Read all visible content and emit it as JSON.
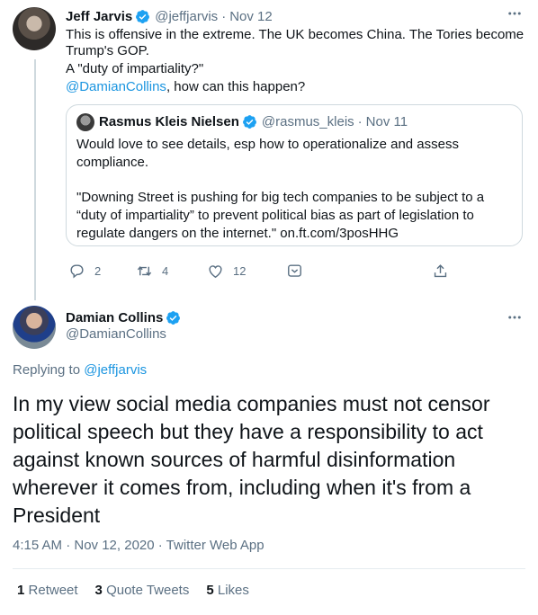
{
  "tweet1": {
    "name": "Jeff Jarvis",
    "handle": "@jeffjarvis",
    "sep": "·",
    "date": "Nov 12",
    "line1": "This is offensive in the extreme. The UK becomes China. The Tories become",
    "line2": "Trump's GOP.",
    "line3": "A \"duty of impartiality?\"",
    "mention": "@DamianCollins",
    "line4_rest": ", how can this happen?"
  },
  "quote": {
    "name": "Rasmus Kleis Nielsen",
    "handle": "@rasmus_kleis",
    "sep": "·",
    "date": "Nov 11",
    "p1_line1": "Would love to see details, esp how to operationalize and assess",
    "p1_line2": "compliance.",
    "p2_line1": "\"Downing Street is pushing for big tech companies to be subject to a",
    "p2_line2": "“duty of impartiality” to prevent political bias as part of legislation to",
    "p2_line3": "regulate dangers on the internet.\" on.ft.com/3posHHG"
  },
  "actions": {
    "reply_count": "2",
    "retweet_count": "4",
    "like_count": "12"
  },
  "tweet2": {
    "name": "Damian Collins",
    "handle": "@DamianCollins",
    "replying_label": "Replying to",
    "replying_to": "@jeffjarvis",
    "line1": "In my view social media companies must not censor",
    "line2": "political speech but they have a responsibility to act",
    "line3": "against known sources of harmful disinformation",
    "line4": "wherever it comes from, including when it's from a",
    "line5": "President",
    "meta": "4:15 AM · Nov 12, 2020 · Twitter Web App",
    "retweets_num": "1",
    "retweets_label": "Retweet",
    "quotes_num": "3",
    "quotes_label": "Quote Tweets",
    "likes_num": "5",
    "likes_label": "Likes"
  },
  "colors": {
    "accent": "#1b95e0",
    "verified": "#1da1f2",
    "muted": "#5b7083",
    "border": "#cfd9de"
  },
  "icons": [
    "verified-icon",
    "more-icon",
    "reply-icon",
    "retweet-icon",
    "like-icon",
    "analytics-icon",
    "share-icon"
  ]
}
